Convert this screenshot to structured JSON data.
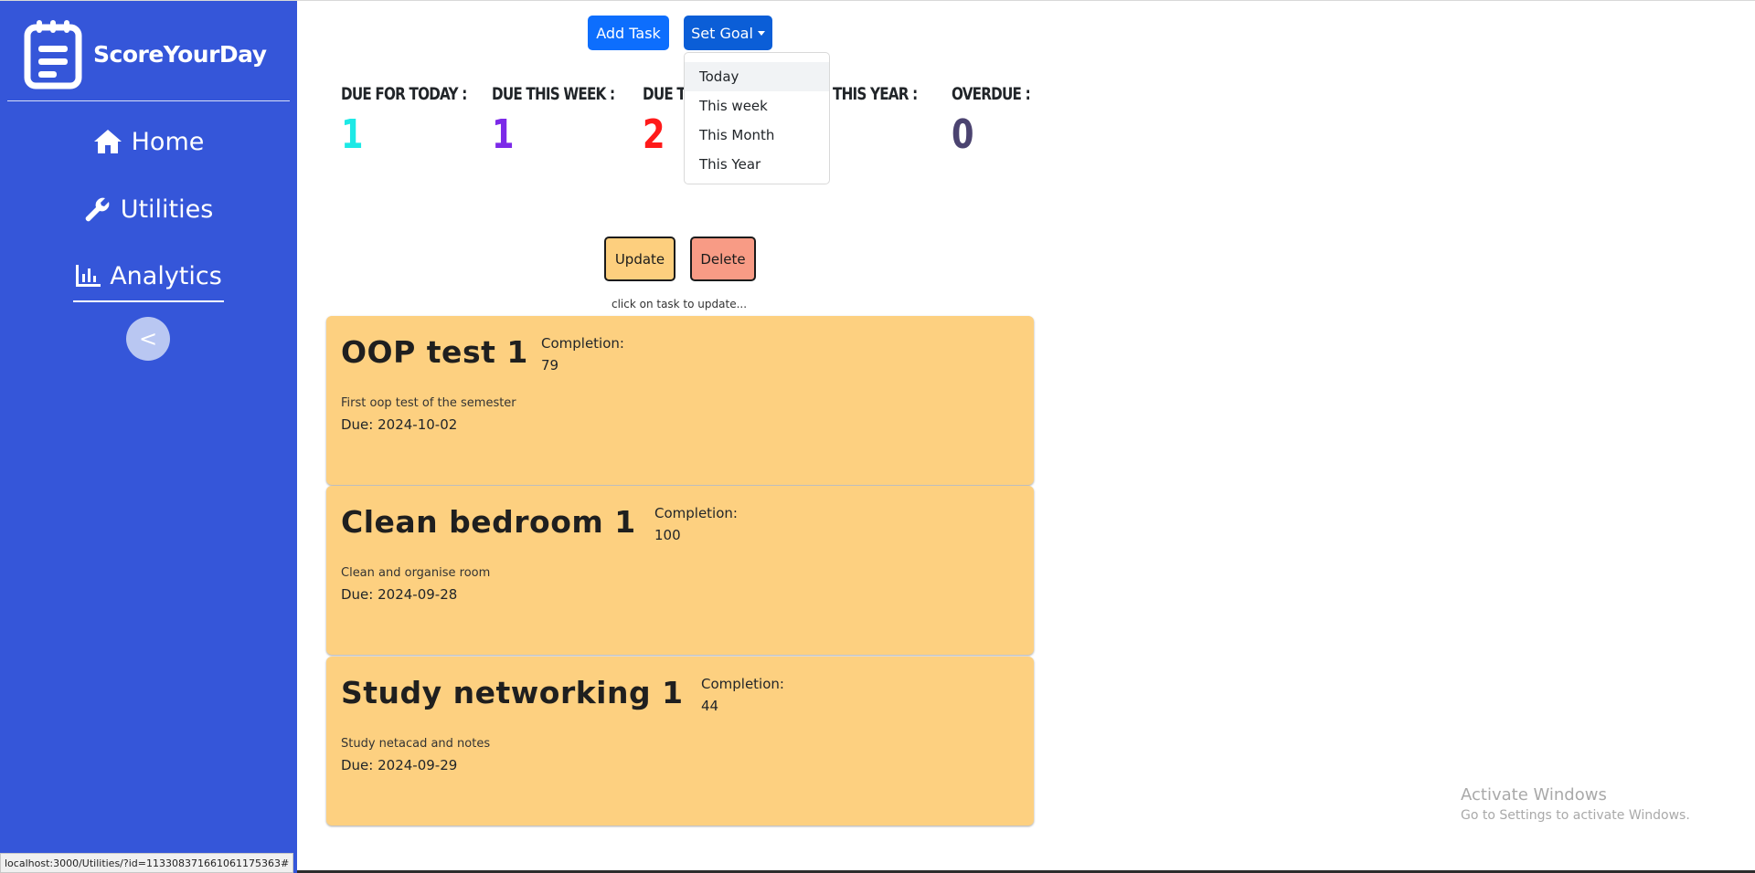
{
  "app": {
    "name": "ScoreYourDay"
  },
  "sidebar": {
    "items": [
      {
        "label": "Home",
        "icon": "home-icon"
      },
      {
        "label": "Utilities",
        "icon": "wrench-icon"
      },
      {
        "label": "Analytics",
        "icon": "bar-chart-icon"
      }
    ],
    "collapse_label": "<",
    "bg_color": "#3556d9"
  },
  "toolbar": {
    "add_task_label": "Add Task",
    "set_goal_label": "Set Goal"
  },
  "goal_dropdown": {
    "options": [
      "Today",
      "This week",
      "This Month",
      "This Year"
    ],
    "highlighted": "Today"
  },
  "stats": [
    {
      "label": "DUE FOR TODAY :",
      "value": "1",
      "color": "#1de9e6"
    },
    {
      "label": "DUE THIS WEEK :",
      "value": "1",
      "color": "#7c2ae8"
    },
    {
      "label": "DUE TH",
      "value": "2",
      "color": "#ff1a1a"
    },
    {
      "label": "THIS YEAR :",
      "value": "",
      "color": "#212529"
    },
    {
      "label": "OVERDUE :",
      "value": "0",
      "color": "#4b4370"
    }
  ],
  "actions": {
    "update_label": "Update",
    "delete_label": "Delete",
    "hint": "click on task to update..."
  },
  "tasks": [
    {
      "title": "OOP test 1",
      "completion_label": "Completion:",
      "completion": "79",
      "description": "First oop test of the semester",
      "due": "Due: 2024-10-02"
    },
    {
      "title": "Clean bedroom 1",
      "completion_label": "Completion:",
      "completion": "100",
      "description": "Clean and organise room",
      "due": "Due: 2024-09-28"
    },
    {
      "title": "Study networking 1",
      "completion_label": "Completion:",
      "completion": "44",
      "description": "Study netacad and notes",
      "due": "Due: 2024-09-29"
    }
  ],
  "watermark": {
    "title": "Activate Windows",
    "subtitle": "Go to Settings to activate Windows."
  },
  "status_bar": {
    "url": "localhost:3000/Utilities/?id=113308371661061175363#"
  }
}
